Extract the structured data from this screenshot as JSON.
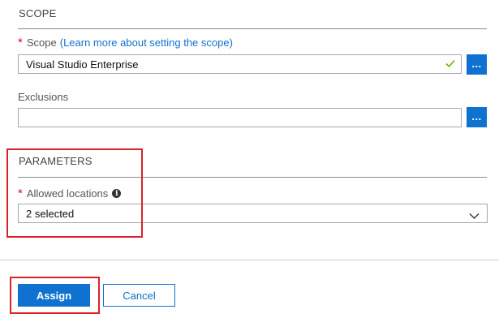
{
  "scope_section": {
    "title": "SCOPE",
    "scope_label": "Scope",
    "scope_link_open": "(",
    "scope_link": "Learn more about setting the scope",
    "scope_link_close": ")",
    "scope_value": "Visual Studio Enterprise",
    "scope_browse": "...",
    "exclusions_label": "Exclusions",
    "exclusions_value": "",
    "exclusions_browse": "..."
  },
  "parameters_section": {
    "title": "PARAMETERS",
    "allowed_locations_label": "Allowed locations",
    "allowed_locations_value": "2 selected"
  },
  "footer": {
    "assign_label": "Assign",
    "cancel_label": "Cancel"
  },
  "colors": {
    "accent": "#0f72d1",
    "required": "#e00b1c",
    "highlight": "#d8232a",
    "valid_check": "#6bb700"
  },
  "icons": {
    "valid": "check-icon",
    "info": "info-icon",
    "dropdown": "chevron-down-icon"
  }
}
